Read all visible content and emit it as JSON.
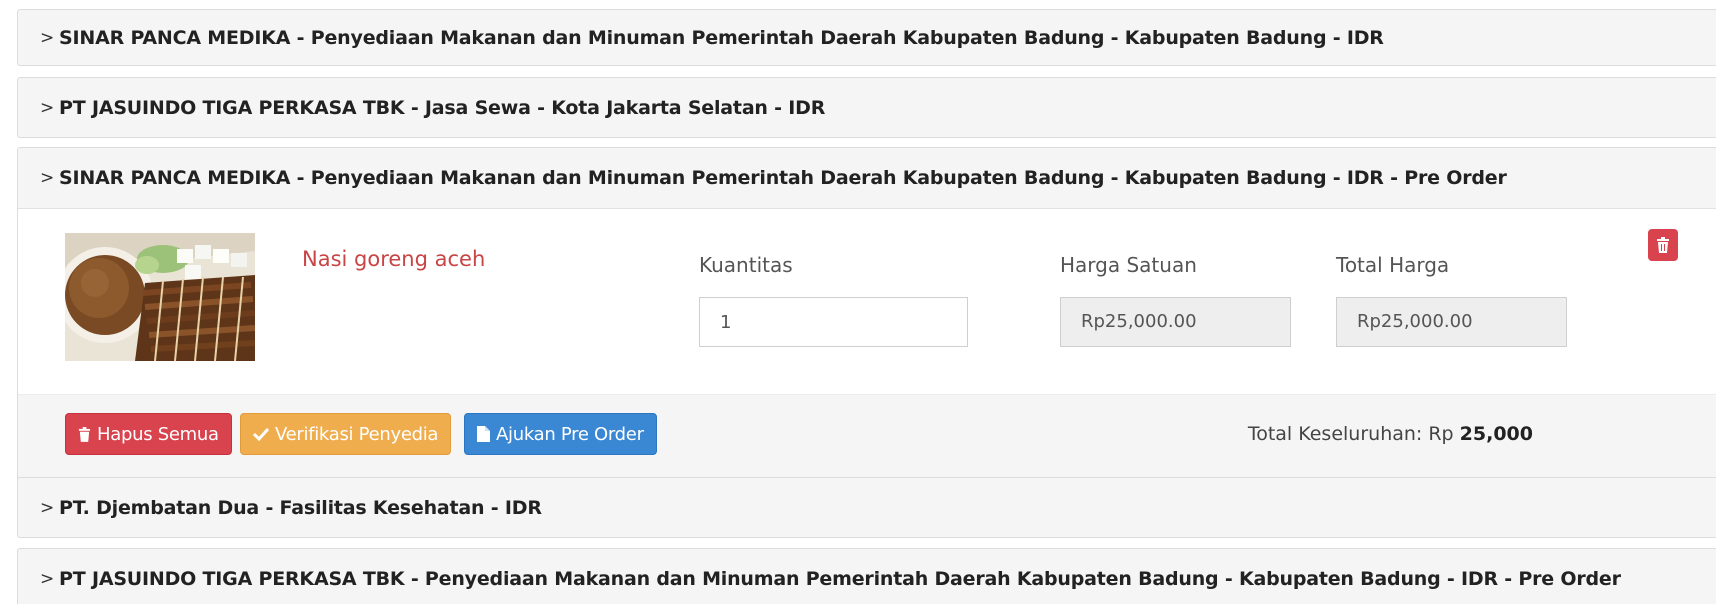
{
  "vendors": [
    {
      "chevron": ">",
      "title": "SINAR PANCA MEDIKA - Penyediaan Makanan dan Minuman Pemerintah Daerah Kabupaten Badung - Kabupaten Badung - IDR"
    },
    {
      "chevron": ">",
      "title": "PT JASUINDO TIGA PERKASA TBK - Jasa Sewa - Kota Jakarta Selatan - IDR"
    },
    {
      "chevron": ">",
      "title": "SINAR PANCA MEDIKA - Penyediaan Makanan dan Minuman Pemerintah Daerah Kabupaten Badung - Kabupaten Badung - IDR - Pre Order"
    },
    {
      "chevron": ">",
      "title": "PT. Djembatan Dua - Fasilitas Kesehatan - IDR"
    },
    {
      "chevron": ">",
      "title": "PT JASUINDO TIGA PERKASA TBK - Penyediaan Makanan dan Minuman Pemerintah Daerah Kabupaten Badung - Kabupaten Badung - IDR - Pre Order"
    }
  ],
  "cart": {
    "product_name": "Nasi goreng aceh",
    "quantity_label": "Kuantitas",
    "quantity_value": "1",
    "unit_price_label": "Harga Satuan",
    "unit_price_value": "Rp25,000.00",
    "total_price_label": "Total Harga",
    "total_price_value": "Rp25,000.00",
    "delete_icon": "trash-icon"
  },
  "actions": {
    "delete_all": "Hapus Semua",
    "verify_vendor": "Verifikasi Penyedia",
    "submit_preorder": "Ajukan Pre Order"
  },
  "summary": {
    "label": "Total Keseluruhan: Rp",
    "amount": "25,000"
  },
  "colors": {
    "danger": "#d9434e",
    "warning": "#f0ad4e",
    "primary": "#3a87d4",
    "product_name": "#c94444"
  }
}
